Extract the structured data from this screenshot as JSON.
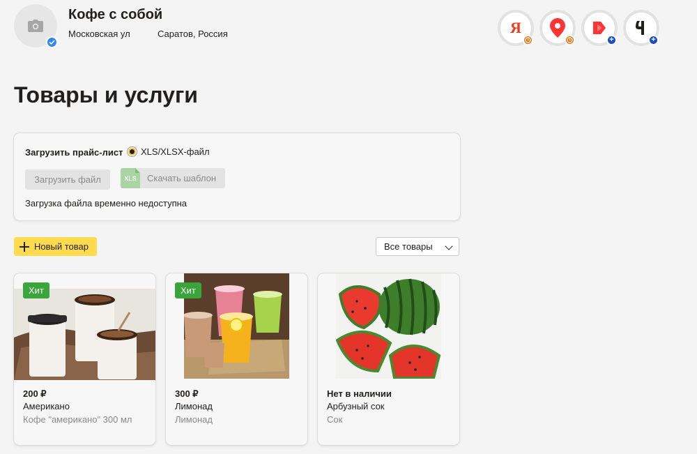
{
  "header": {
    "org_name": "Кофе с собой",
    "street": "Московская ул",
    "city": "Саратов, Россия",
    "services": [
      {
        "name": "yandex",
        "glyph": "Я",
        "badge": "clock"
      },
      {
        "name": "maps",
        "badge": "clock"
      },
      {
        "name": "market",
        "badge": "+"
      },
      {
        "name": "other",
        "badge": "+"
      }
    ]
  },
  "page": {
    "title": "Товары и услуги"
  },
  "upload": {
    "label": "Загрузить прайс-лист",
    "format_option": "XLS/XLSX-файл",
    "upload_button": "Загрузить файл",
    "xls_badge": "XLS",
    "template_button": "Скачать шаблон",
    "note": "Загрузка файла временно недоступна"
  },
  "toolbar": {
    "new_item": "Новый товар",
    "filter_value": "Все товары"
  },
  "products": [
    {
      "badge": "Хит",
      "price": "200 ₽",
      "name": "Американо",
      "description": "Кофе \"американо\" 300 мл"
    },
    {
      "badge": "Хит",
      "price": "300 ₽",
      "name": "Лимонад",
      "description": "Лимонад"
    },
    {
      "price": "Нет в наличии",
      "name": "Арбузный сок",
      "description": "Сок"
    }
  ],
  "colors": {
    "accent_yellow": "#ffdb4d",
    "hit_green": "#3aa53a",
    "badge_orange": "#f06c00",
    "badge_blue": "#1a4ec6"
  }
}
